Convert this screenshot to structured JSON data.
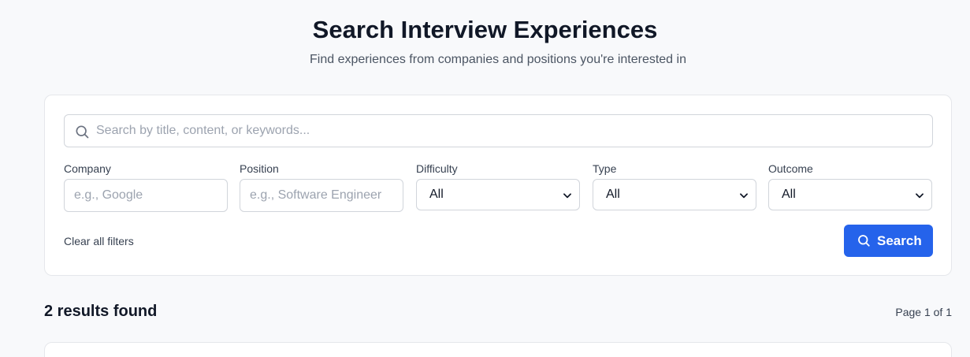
{
  "header": {
    "title": "Search Interview Experiences",
    "subtitle": "Find experiences from companies and positions you're interested in"
  },
  "search": {
    "placeholder": "Search by title, content, or keywords...",
    "value": "",
    "icon": "search-icon"
  },
  "filters": {
    "company": {
      "label": "Company",
      "placeholder": "e.g., Google"
    },
    "position": {
      "label": "Position",
      "placeholder": "e.g., Software Engineer"
    },
    "difficulty": {
      "label": "Difficulty",
      "selected": "All"
    },
    "type": {
      "label": "Type",
      "selected": "All"
    },
    "outcome": {
      "label": "Outcome",
      "selected": "All"
    }
  },
  "actions": {
    "clear_label": "Clear all filters",
    "search_label": "Search"
  },
  "results": {
    "count_text": "2 results found",
    "page_text": "Page 1 of 1"
  },
  "colors": {
    "accent": "#2563eb",
    "background": "#f8f9fb"
  }
}
